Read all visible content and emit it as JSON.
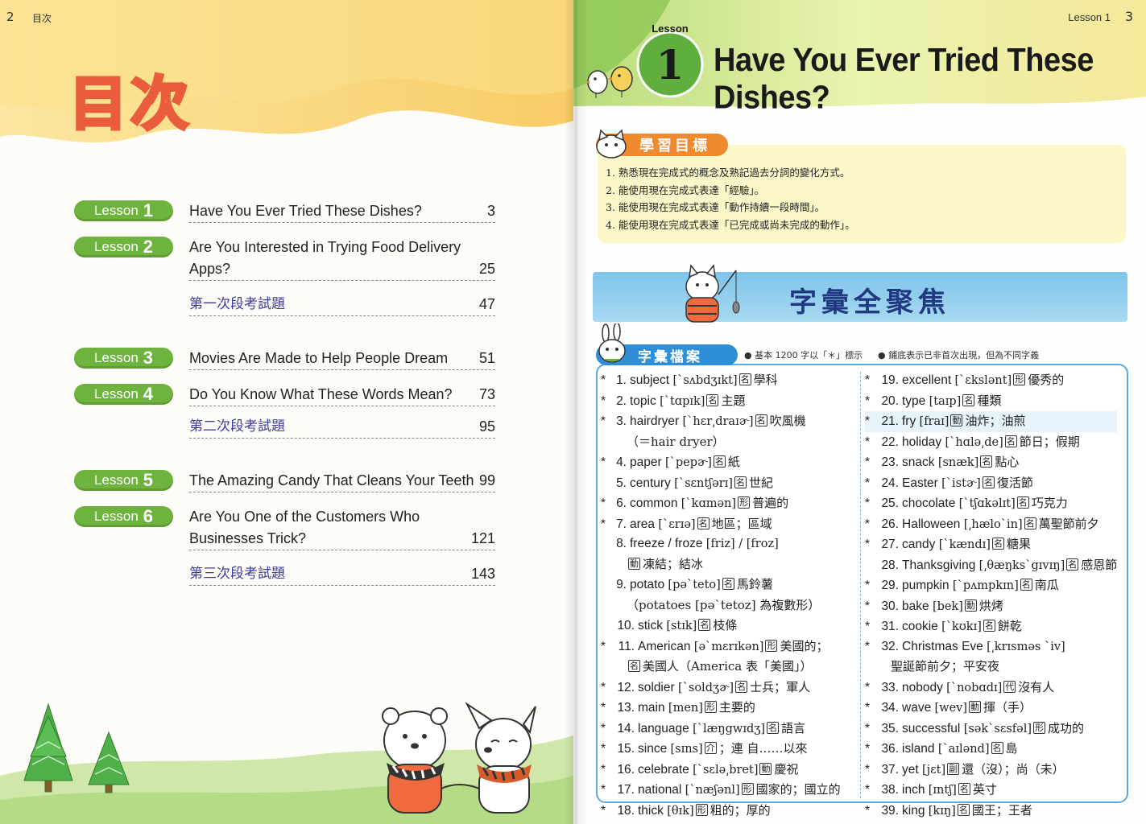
{
  "left_page": {
    "page_number": "2",
    "header": "目次",
    "title": "目次",
    "toc": [
      {
        "pill_word": "Lesson",
        "pill_num": "1",
        "lines": [
          {
            "text": "Have You Ever Tried These Dishes?",
            "page": "3"
          }
        ]
      },
      {
        "pill_word": "Lesson",
        "pill_num": "2",
        "lines": [
          {
            "text": "Are You Interested in Trying Food Delivery",
            "page": ""
          },
          {
            "text": "Apps?",
            "page": "25"
          }
        ]
      },
      {
        "exam": "第一次段考試題",
        "page": "47"
      },
      {
        "pill_word": "Lesson",
        "pill_num": "3",
        "lines": [
          {
            "text": "Movies Are Made to Help People Dream",
            "page": "51"
          }
        ]
      },
      {
        "pill_word": "Lesson",
        "pill_num": "4",
        "lines": [
          {
            "text": "Do You Know What These Words Mean?",
            "page": "73"
          }
        ]
      },
      {
        "exam": "第二次段考試題",
        "page": "95"
      },
      {
        "pill_word": "Lesson",
        "pill_num": "5",
        "lines": [
          {
            "text": "The Amazing Candy That Cleans Your Teeth",
            "page": "99"
          }
        ]
      },
      {
        "pill_word": "Lesson",
        "pill_num": "6",
        "lines": [
          {
            "text": "Are You One of the Customers Who",
            "page": ""
          },
          {
            "text": "Businesses Trick?",
            "page": "121"
          }
        ]
      },
      {
        "exam": "第三次段考試題",
        "page": "143"
      }
    ]
  },
  "right_page": {
    "header_lesson": "Lesson 1",
    "page_number": "3",
    "badge_word": "Lesson",
    "badge_num": "1",
    "lesson_title": "Have You Ever Tried These Dishes?",
    "goals_tag": "學習目標",
    "goals": [
      "1. 熟悉現在完成式的概念及熟記過去分詞的變化方式。",
      "2. 能使用現在完成式表達「經驗」。",
      "3. 能使用現在完成式表達「動作持續一段時間」。",
      "4. 能使用現在完成式表達「已完成或尚未完成的動作」。"
    ],
    "vocab_banner": "字彙全聚焦",
    "vocab_tag": "字彙檔案",
    "note_1": "● 基本 1200 字以「＊」標示",
    "note_2": "● 鋪底表示已非首次出現，但為不同字義",
    "vocab_left": [
      {
        "star": "*",
        "num": "1.",
        "word": "subject",
        "ph": "[ˋsʌbdʒɪkt]",
        "pos": "名",
        "zh": "學科"
      },
      {
        "star": "*",
        "num": "2.",
        "word": "topic",
        "ph": "[ˋtɑpɪk]",
        "pos": "名",
        "zh": "主題"
      },
      {
        "star": "*",
        "num": "3.",
        "word": "hairdryer",
        "ph": "[ˋhɛr͵draɪɚ]",
        "pos": "名",
        "zh": "吹風機"
      },
      {
        "cont": "（＝hair dryer）"
      },
      {
        "star": "*",
        "num": "4.",
        "word": "paper",
        "ph": "[ˋpepɚ]",
        "pos": "名",
        "zh": "紙"
      },
      {
        "star": "",
        "num": "5.",
        "word": "century",
        "ph": "[ˋsɛntʃərɪ]",
        "pos": "名",
        "zh": "世紀"
      },
      {
        "star": "*",
        "num": "6.",
        "word": "common",
        "ph": "[ˋkɑmən]",
        "pos": "形",
        "zh": "普遍的"
      },
      {
        "star": "*",
        "num": "7.",
        "word": "area",
        "ph": "[ˋɛrɪə]",
        "pos": "名",
        "zh": "地區；區域"
      },
      {
        "star": "",
        "num": "8.",
        "word": "freeze / froze",
        "ph": "[friz] / [froz]",
        "pos": "",
        "zh": ""
      },
      {
        "cont_pos": "動",
        "cont": "凍結；結冰"
      },
      {
        "star": "",
        "num": "9.",
        "word": "potato",
        "ph": "[pəˋteto]",
        "pos": "名",
        "zh": "馬鈴薯"
      },
      {
        "cont": "（potatoes [pəˋtetoz] 為複數形）"
      },
      {
        "star": "",
        "num": "10.",
        "word": "stick",
        "ph": "[stɪk]",
        "pos": "名",
        "zh": "枝條"
      },
      {
        "star": "*",
        "num": "11.",
        "word": "American",
        "ph": "[əˋmɛrɪkən]",
        "pos": "形",
        "zh": "美國的；"
      },
      {
        "cont_pos": "名",
        "cont": "美國人（America 表「美國」）"
      },
      {
        "star": "*",
        "num": "12.",
        "word": "soldier",
        "ph": "[ˋsoldʒɚ]",
        "pos": "名",
        "zh": "士兵；軍人"
      },
      {
        "star": "*",
        "num": "13.",
        "word": "main",
        "ph": "[men]",
        "pos": "形",
        "zh": "主要的"
      },
      {
        "star": "*",
        "num": "14.",
        "word": "language",
        "ph": "[ˋlæŋgwɪdʒ]",
        "pos": "名",
        "zh": "語言"
      },
      {
        "star": "*",
        "num": "15.",
        "word": "since",
        "ph": "[sɪns]",
        "pos": "介",
        "zh": "；連 自……以來"
      },
      {
        "star": "*",
        "num": "16.",
        "word": "celebrate",
        "ph": "[ˋsɛlə͵bret]",
        "pos": "動",
        "zh": "慶祝"
      },
      {
        "star": "*",
        "num": "17.",
        "word": "national",
        "ph": "[ˋnæʃənl]",
        "pos": "形",
        "zh": "國家的；國立的"
      },
      {
        "star": "*",
        "num": "18.",
        "word": "thick",
        "ph": "[θɪk]",
        "pos": "形",
        "zh": "粗的；厚的"
      }
    ],
    "vocab_right": [
      {
        "star": "*",
        "num": "19.",
        "word": "excellent",
        "ph": "[ˋɛkslənt]",
        "pos": "形",
        "zh": "優秀的"
      },
      {
        "star": "*",
        "num": "20.",
        "word": "type",
        "ph": "[taɪp]",
        "pos": "名",
        "zh": "種類"
      },
      {
        "star": "*",
        "num": "21.",
        "word": "fry",
        "ph": "[fraɪ]",
        "pos": "動",
        "zh": "油炸；油煎",
        "hl": true
      },
      {
        "star": "*",
        "num": "22.",
        "word": "holiday",
        "ph": "[ˋhɑlə͵de]",
        "pos": "名",
        "zh": "節日；假期"
      },
      {
        "star": "*",
        "num": "23.",
        "word": "snack",
        "ph": "[snæk]",
        "pos": "名",
        "zh": "點心"
      },
      {
        "star": "*",
        "num": "24.",
        "word": "Easter",
        "ph": "[ˋistɚ]",
        "pos": "名",
        "zh": "復活節"
      },
      {
        "star": "*",
        "num": "25.",
        "word": "chocolate",
        "ph": "[ˋtʃɑkəlɪt]",
        "pos": "名",
        "zh": "巧克力"
      },
      {
        "star": "*",
        "num": "26.",
        "word": "Halloween",
        "ph": "[͵hæloˋin]",
        "pos": "名",
        "zh": "萬聖節前夕"
      },
      {
        "star": "*",
        "num": "27.",
        "word": "candy",
        "ph": "[ˋkændɪ]",
        "pos": "名",
        "zh": "糖果"
      },
      {
        "star": "",
        "num": "28.",
        "word": "Thanksgiving",
        "ph": "[͵θæŋksˋgɪvɪŋ]",
        "pos": "名",
        "zh": "感恩節"
      },
      {
        "star": "*",
        "num": "29.",
        "word": "pumpkin",
        "ph": "[ˋpʌmpkɪn]",
        "pos": "名",
        "zh": "南瓜"
      },
      {
        "star": "*",
        "num": "30.",
        "word": "bake",
        "ph": "[bek]",
        "pos": "動",
        "zh": "烘烤"
      },
      {
        "star": "*",
        "num": "31.",
        "word": "cookie",
        "ph": "[ˋkʊkɪ]",
        "pos": "名",
        "zh": "餅乾"
      },
      {
        "star": "*",
        "num": "32.",
        "word": "Christmas Eve",
        "ph": "[͵krɪsməs ˋiv]",
        "pos": "",
        "zh": ""
      },
      {
        "cont": "聖誕節前夕；平安夜"
      },
      {
        "star": "*",
        "num": "33.",
        "word": "nobody",
        "ph": "[ˋnobɑdɪ]",
        "pos": "代",
        "zh": "沒有人"
      },
      {
        "star": "*",
        "num": "34.",
        "word": "wave",
        "ph": "[wev]",
        "pos": "動",
        "zh": "揮（手）"
      },
      {
        "star": "*",
        "num": "35.",
        "word": "successful",
        "ph": "[səkˋsɛsfəl]",
        "pos": "形",
        "zh": "成功的"
      },
      {
        "star": "*",
        "num": "36.",
        "word": "island",
        "ph": "[ˋaɪlənd]",
        "pos": "名",
        "zh": "島"
      },
      {
        "star": "*",
        "num": "37.",
        "word": "yet",
        "ph": "[jɛt]",
        "pos": "副",
        "zh": "還（沒）；尚（未）"
      },
      {
        "star": "*",
        "num": "38.",
        "word": "inch",
        "ph": "[ɪntʃ]",
        "pos": "名",
        "zh": "英寸"
      },
      {
        "star": "*",
        "num": "39.",
        "word": "king",
        "ph": "[kɪŋ]",
        "pos": "名",
        "zh": "國王；王者"
      }
    ]
  },
  "colors": {
    "lesson_pill": "#6fb33f",
    "toc_title_stroke": "#e95c3c",
    "exam_text": "#3c3ca0",
    "goal_tag": "#f08a2e",
    "goal_box": "#fbf7c9",
    "vocab_tag": "#2f8fd6",
    "vocab_border": "#5aa9df",
    "vocab_title": "#1f3a80"
  }
}
